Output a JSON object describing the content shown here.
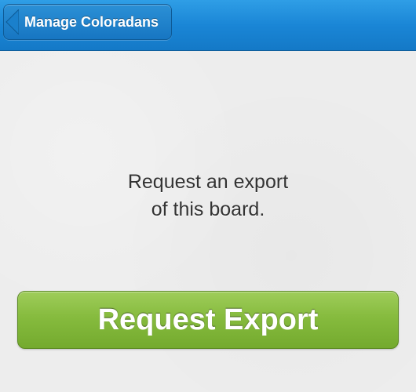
{
  "navbar": {
    "back_label": "Manage Coloradans"
  },
  "main": {
    "message_line1": "Request an export",
    "message_line2": "of this board.",
    "primary_action_label": "Request Export"
  },
  "colors": {
    "navbar": "#1a86d6",
    "primary_button": "#86bb3e",
    "background": "#ededed"
  }
}
